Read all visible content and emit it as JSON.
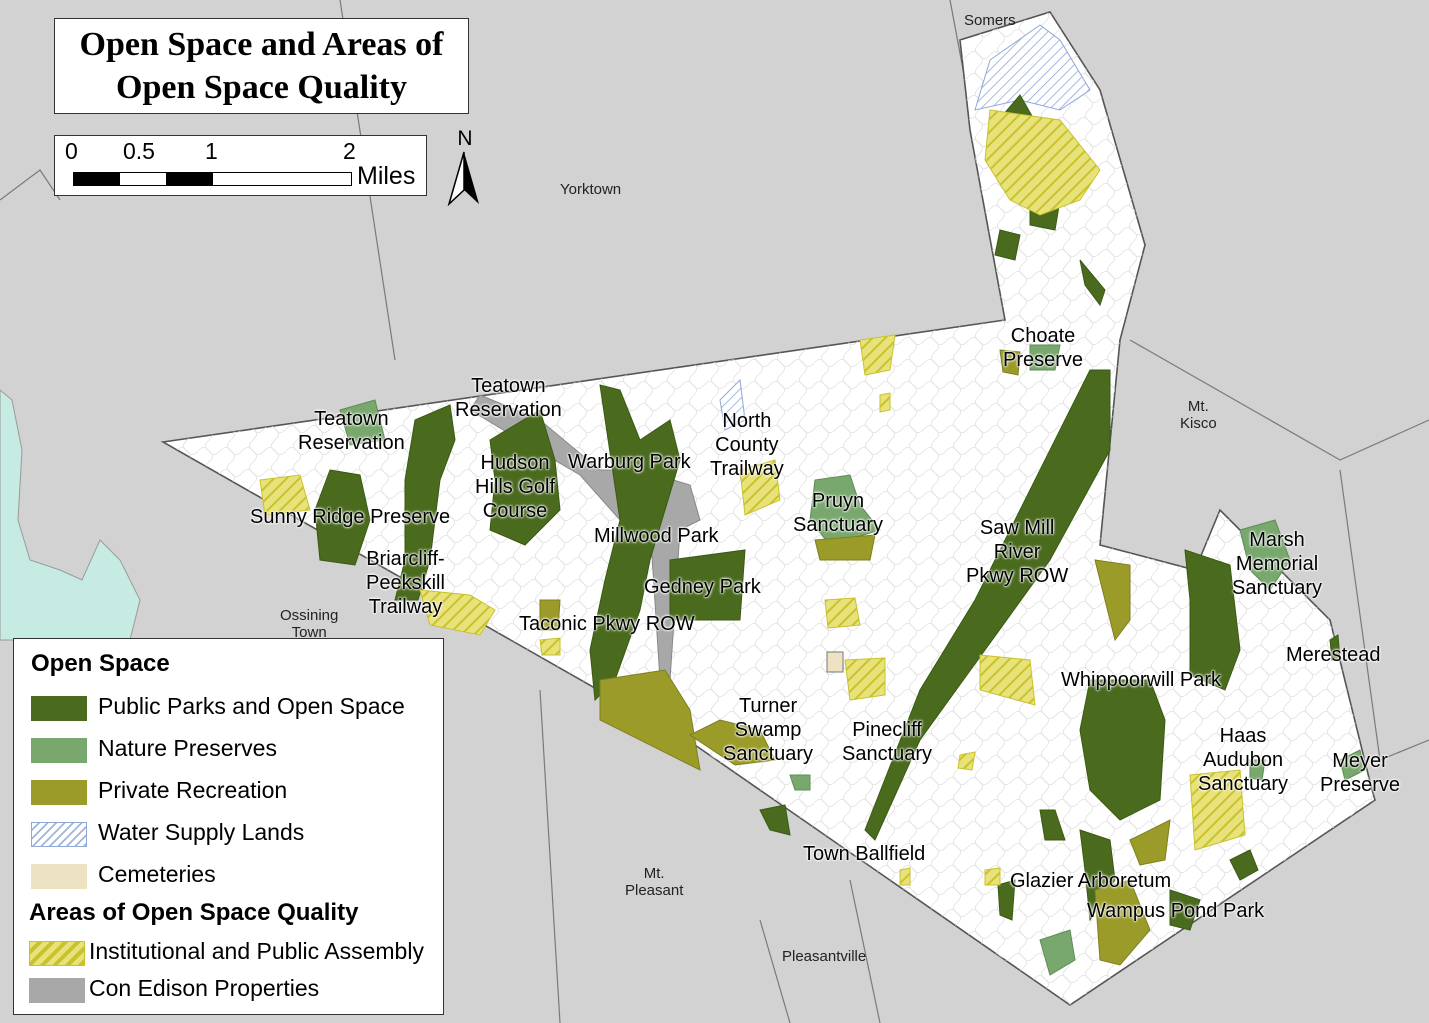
{
  "title": {
    "line1": "Open Space and Areas of",
    "line2": "Open Space Quality"
  },
  "scale": {
    "ticks": [
      "0",
      "0.5",
      "1",
      "2"
    ],
    "unit": "Miles"
  },
  "north": {
    "label": "N"
  },
  "legend": {
    "section1": "Open Space",
    "section2": "Areas of Open Space Quality",
    "items": [
      {
        "label": "Public Parks and Open Space",
        "color": "#4a6b1e"
      },
      {
        "label": "Nature Preserves",
        "color": "#79a86e"
      },
      {
        "label": "Private Recreation",
        "color": "#9b9b2a"
      },
      {
        "label": "Water Supply Lands",
        "color": "#9fb6dc"
      },
      {
        "label": "Cemeteries",
        "color": "#ede3c2"
      },
      {
        "label": "Institutional and Public Assembly",
        "color": "#d9d44e"
      },
      {
        "label": "Con Edison Properties",
        "color": "#a8a8a8"
      }
    ]
  },
  "towns": {
    "somers": "Somers",
    "yorktown": "Yorktown",
    "mtkisco": "Mt.\nKisco",
    "ossining": "Ossining\nTown",
    "mtpleasant": "Mt.\nPleasant",
    "pleasantville": "Pleasantville"
  },
  "places": {
    "choate": "Choate\nPreserve",
    "teatown1": "Teatown\nReservation",
    "teatown2": "Teatown\nReservation",
    "hudsonhills": "Hudson\nHills Golf\nCourse",
    "warburg": "Warburg Park",
    "northcounty": "North\nCounty\nTrailway",
    "pruyn": "Pruyn\nSanctuary",
    "sunnyridge": "Sunny Ridge Preserve",
    "millwood": "Millwood Park",
    "sawmill": "Saw Mill\nRiver\nPkwy ROW",
    "marsh": "Marsh\nMemorial\nSanctuary",
    "briarcliff": "Briarcliff-\nPeekskill\nTrailway",
    "gedney": "Gedney Park",
    "taconic": "Taconic Pkwy ROW",
    "merestead": "Merestead",
    "whippoorwill": "Whippoorwill Park",
    "turner": "Turner\nSwamp\nSanctuary",
    "pinecliff": "Pinecliff\nSanctuary",
    "haas": "Haas\nAudubon\nSanctuary",
    "meyer": "Meyer\nPreserve",
    "townballfield": "Town Ballfield",
    "glazier": "Glazier Arboretum",
    "wampus": "Wampus Pond Park"
  }
}
